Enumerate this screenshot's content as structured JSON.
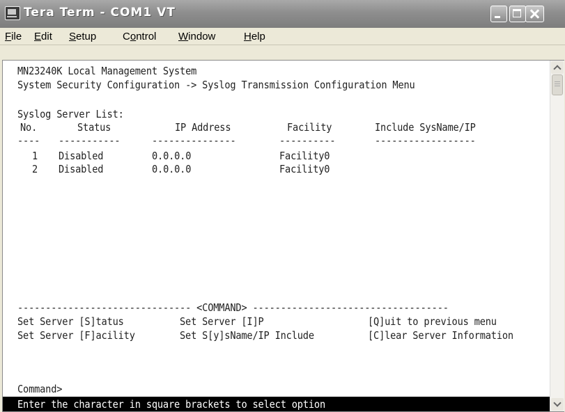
{
  "window": {
    "title": "Tera Term - COM1 VT"
  },
  "menu": {
    "items": [
      {
        "pre": "",
        "key": "F",
        "post": "ile"
      },
      {
        "pre": "",
        "key": "E",
        "post": "dit"
      },
      {
        "pre": "",
        "key": "S",
        "post": "etup"
      },
      {
        "pre": "C",
        "key": "o",
        "post": "ntrol"
      },
      {
        "pre": "",
        "key": "W",
        "post": "indow"
      },
      {
        "pre": "",
        "key": "H",
        "post": "elp"
      }
    ]
  },
  "terminal": {
    "system_name": "MN23240K Local Management System",
    "breadcrumb": "System Security Configuration -> Syslog Transmission Configuration Menu",
    "list_title": "Syslog Server List:",
    "columns": {
      "no": "No.",
      "status": "Status",
      "ip": "IP Address",
      "facility": "Facility",
      "include": "Include SysName/IP"
    },
    "dashes": {
      "no": "----",
      "status": "-----------",
      "ip": "---------------",
      "facility": "----------",
      "include": "------------------"
    },
    "rows": [
      {
        "no": "1",
        "status": "Disabled",
        "ip": "0.0.0.0",
        "facility": "Facility0",
        "include": ""
      },
      {
        "no": "2",
        "status": "Disabled",
        "ip": "0.0.0.0",
        "facility": "Facility0",
        "include": ""
      }
    ],
    "command_divider": "------------------------------- <COMMAND> -----------------------------------",
    "commands": {
      "set_status": "Set Server [S]tatus",
      "set_ip": "Set Server [I]P",
      "quit": "[Q]uit to previous menu",
      "set_facility": "Set Server [F]acility",
      "set_sysname": "Set S[y]sName/IP Include",
      "clear": "[C]lear Server Information"
    },
    "prompt": "Command>",
    "status_message": "Enter the character in square brackets to select option"
  }
}
